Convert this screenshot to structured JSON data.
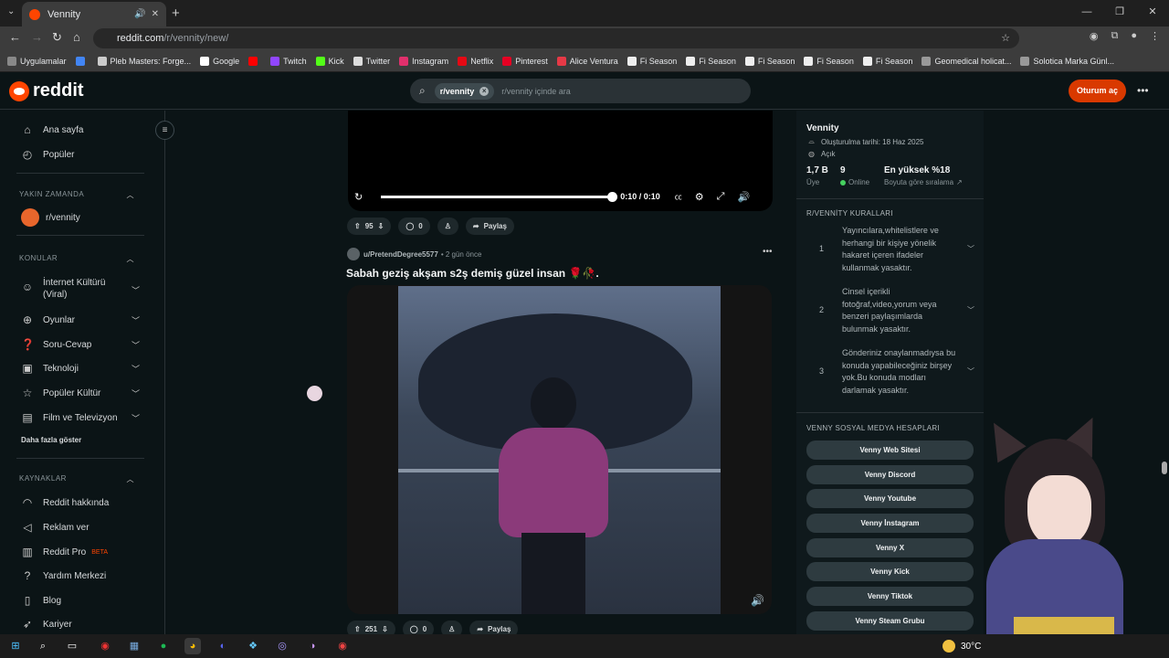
{
  "browser": {
    "tab_title": "Vennity",
    "url_host": "reddit.com",
    "url_path": "/r/vennity/new/",
    "bookmarks": [
      {
        "label": "Uygulamalar",
        "color": "#888888"
      },
      {
        "label": "",
        "color": "#4285f4"
      },
      {
        "label": "Pleb Masters: Forge...",
        "color": "#cccccc"
      },
      {
        "label": "Google",
        "color": "#ffffff"
      },
      {
        "label": "",
        "color": "#ff0000"
      },
      {
        "label": "Twitch",
        "color": "#9146ff"
      },
      {
        "label": "Kick",
        "color": "#53fc18"
      },
      {
        "label": "Twitter",
        "color": "#dddddd"
      },
      {
        "label": "Instagram",
        "color": "#e1306c"
      },
      {
        "label": "Netflix",
        "color": "#e50914"
      },
      {
        "label": "Pinterest",
        "color": "#e60023"
      },
      {
        "label": "Alice Ventura",
        "color": "#e63946"
      },
      {
        "label": "Fi Season",
        "color": "#eeeeee"
      },
      {
        "label": "Fi Season",
        "color": "#eeeeee"
      },
      {
        "label": "Fi Season",
        "color": "#eeeeee"
      },
      {
        "label": "Fi Season",
        "color": "#eeeeee"
      },
      {
        "label": "Fi Season",
        "color": "#eeeeee"
      },
      {
        "label": "Geomedical holicat...",
        "color": "#999999"
      },
      {
        "label": "Solotica Marka Günl...",
        "color": "#999999"
      }
    ]
  },
  "header": {
    "logo_text": "reddit",
    "search_chip": "r/vennity",
    "search_placeholder": "r/vennity içinde ara",
    "login_label": "Oturum aç"
  },
  "sidebar": {
    "main": [
      {
        "label": "Ana sayfa",
        "icon": "home-icon"
      },
      {
        "label": "Popüler",
        "icon": "popular-icon"
      }
    ],
    "recent_title": "YAKIN ZAMANDA",
    "recent_item": "r/vennity",
    "topics_title": "KONULAR",
    "topics": [
      {
        "label": "İnternet Kültürü (Viral)"
      },
      {
        "label": "Oyunlar"
      },
      {
        "label": "Soru-Cevap"
      },
      {
        "label": "Teknoloji"
      },
      {
        "label": "Popüler Kültür"
      },
      {
        "label": "Film ve Televizyon"
      }
    ],
    "show_more": "Daha fazla göster",
    "resources_title": "KAYNAKLAR",
    "resources": [
      {
        "label": "Reddit hakkında"
      },
      {
        "label": "Reklam ver"
      },
      {
        "label": "Reddit Pro"
      },
      {
        "label": "Yardım Merkezi"
      },
      {
        "label": "Blog"
      },
      {
        "label": "Kariyer"
      }
    ],
    "pro_badge": "BETA"
  },
  "feed": {
    "video_time": "0:10 / 0:10",
    "video_progress": 1.0,
    "post1": {
      "votes": "95",
      "comments": "0",
      "share": "Paylaş"
    },
    "post2": {
      "user": "u/PretendDegree5577",
      "ago": "• 2 gün önce",
      "title": "Sabah geziş akşam s2ş demiş güzel insan 🌹🥀.",
      "votes": "251",
      "comments": "0",
      "share": "Paylaş"
    }
  },
  "community": {
    "name": "Vennity",
    "created": "Oluşturulma tarihi: 18 Haz 2025",
    "visibility": "Açık",
    "members": "1,7 B",
    "members_label": "Üye",
    "online": "9",
    "online_label": "Online",
    "rank": "En yüksek %18",
    "rank_label": "Boyuta göre sıralama",
    "rules_title": "R/VENNİTY KURALLARI",
    "rules": [
      {
        "num": "1",
        "text": "Yayıncılara,whitelistlere ve herhangi bir kişiye yönelik hakaret içeren ifadeler kullanmak yasaktır."
      },
      {
        "num": "2",
        "text": "Cinsel içerikli fotoğraf,video,yorum veya benzeri paylaşımlarda bulunmak yasaktır."
      },
      {
        "num": "3",
        "text": "Gönderiniz onaylanmadıysa bu konuda yapabileceğiniz birşey yok.Bu konuda modları darlamak yasaktır."
      }
    ],
    "links_title": "VENNY SOSYAL MEDYA HESAPLARI",
    "links": [
      {
        "label": "Venny Web Sitesi"
      },
      {
        "label": "Venny Discord"
      },
      {
        "label": "Venny Youtube"
      },
      {
        "label": "Venny İnstagram"
      },
      {
        "label": "Venny X"
      },
      {
        "label": "Venny Kick"
      },
      {
        "label": "Venny Tiktok"
      },
      {
        "label": "Venny Steam Grubu"
      }
    ]
  },
  "taskbar": {
    "temperature": "30°C"
  },
  "colors": {
    "accent": "#ff4500",
    "login": "#d93900",
    "online": "#46d160"
  }
}
